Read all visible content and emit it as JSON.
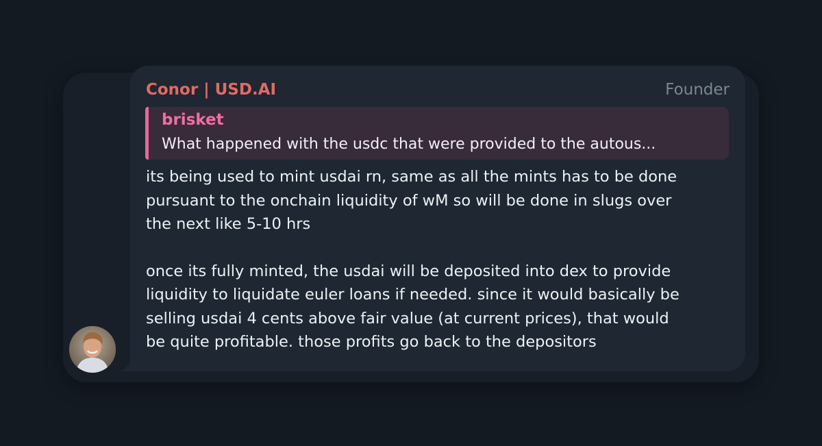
{
  "message": {
    "sender_name": "Conor | USD.AI",
    "sender_role": "Founder",
    "reply": {
      "author": "brisket",
      "text": "What happened with the usdc that were provided to the autous..."
    },
    "paragraph1_lines": [
      "its being used to mint usdai rn, same as all the mints has to be done",
      "pursuant to the onchain liquidity of wM so will be done in slugs over",
      "the next like 5-10 hrs"
    ],
    "paragraph2_lines": [
      "once its fully minted, the usdai will be deposited into dex to provide",
      "liquidity to liquidate euler loans if needed. since it would basically be",
      "selling usdai 4 cents above fair value (at current prices), that would",
      "be quite profitable. those profits go back to the depositors"
    ]
  },
  "colors": {
    "background": "#141a22",
    "bubble": "#1e2732",
    "sender_name": "#e26b63",
    "role": "#7b8794",
    "reply_accent": "#e7679a",
    "reply_background": "#382b3a",
    "text": "#eef1f5"
  },
  "avatar": {
    "icon": "user-avatar-photo"
  }
}
